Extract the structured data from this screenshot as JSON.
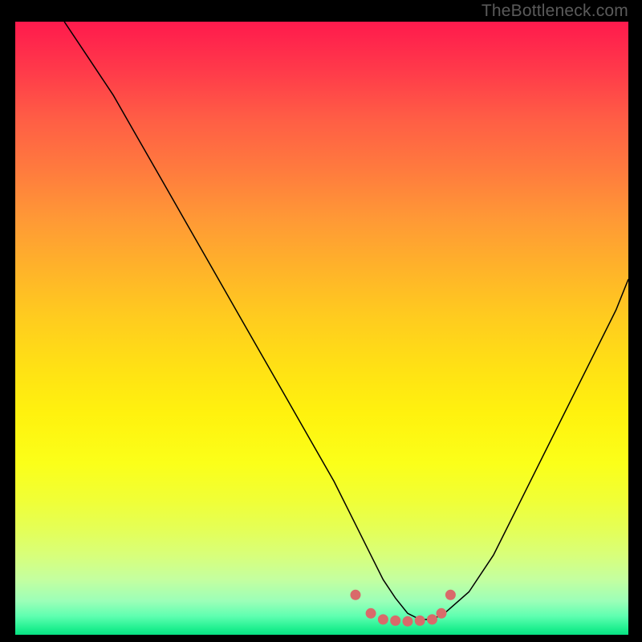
{
  "watermark": "TheBottleneck.com",
  "chart_data": {
    "type": "line",
    "title": "",
    "xlabel": "",
    "ylabel": "",
    "xlim": [
      0,
      100
    ],
    "ylim": [
      0,
      100
    ],
    "grid": false,
    "legend": false,
    "series": [
      {
        "name": "bottleneck-curve",
        "x": [
          8,
          12,
          16,
          20,
          24,
          28,
          32,
          36,
          40,
          44,
          48,
          52,
          55,
          58,
          60,
          62,
          64,
          66,
          68,
          70,
          74,
          78,
          82,
          86,
          90,
          94,
          98,
          100
        ],
        "y": [
          100,
          94,
          88,
          81,
          74,
          67,
          60,
          53,
          46,
          39,
          32,
          25,
          19,
          13,
          9,
          6,
          3.5,
          2.5,
          2.5,
          3.5,
          7,
          13,
          21,
          29,
          37,
          45,
          53,
          58
        ],
        "color": "#000000",
        "width": 1.5
      }
    ],
    "highlight_points": {
      "description": "flat-bottom highlight markers",
      "color": "#d96a6a",
      "radius_px": 6.5,
      "points_x": [
        55.5,
        58,
        60,
        62,
        64,
        66,
        68,
        69.5,
        71
      ],
      "points_y": [
        6.5,
        3.5,
        2.5,
        2.3,
        2.2,
        2.3,
        2.5,
        3.5,
        6.5
      ]
    },
    "background_gradient": {
      "top_color": "#ff1a4d",
      "bottom_color": "#07e083",
      "stops": [
        "red",
        "orange",
        "yellow",
        "green"
      ]
    }
  }
}
